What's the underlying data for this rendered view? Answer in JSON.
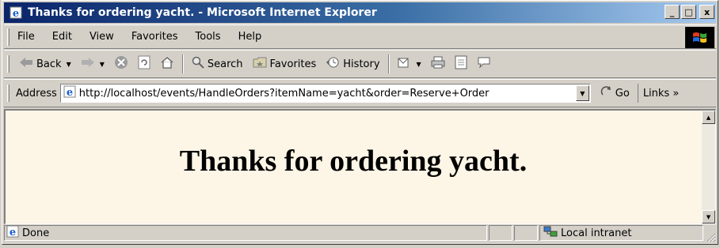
{
  "window": {
    "title": "Thanks for ordering yacht. - Microsoft Internet Explorer",
    "controls": {
      "minimize": "_",
      "maximize": "□",
      "close": "x"
    }
  },
  "menubar": {
    "items": [
      {
        "label": "File"
      },
      {
        "label": "Edit"
      },
      {
        "label": "View"
      },
      {
        "label": "Favorites"
      },
      {
        "label": "Tools"
      },
      {
        "label": "Help"
      }
    ]
  },
  "toolbar": {
    "back_label": "Back",
    "search_label": "Search",
    "favorites_label": "Favorites",
    "history_label": "History"
  },
  "addressbar": {
    "label": "Address",
    "url": "http://localhost/events/HandleOrders?itemName=yacht&order=Reserve+Order",
    "go_label": "Go",
    "links_label": "Links »"
  },
  "page": {
    "heading": "Thanks for ordering yacht.",
    "background_color": "#fdf5e6"
  },
  "statusbar": {
    "status_text": "Done",
    "zone_text": "Local intranet"
  },
  "colors": {
    "titlebar_start": "#0a246a",
    "titlebar_end": "#a6caf0",
    "chrome": "#d4d0c8"
  }
}
